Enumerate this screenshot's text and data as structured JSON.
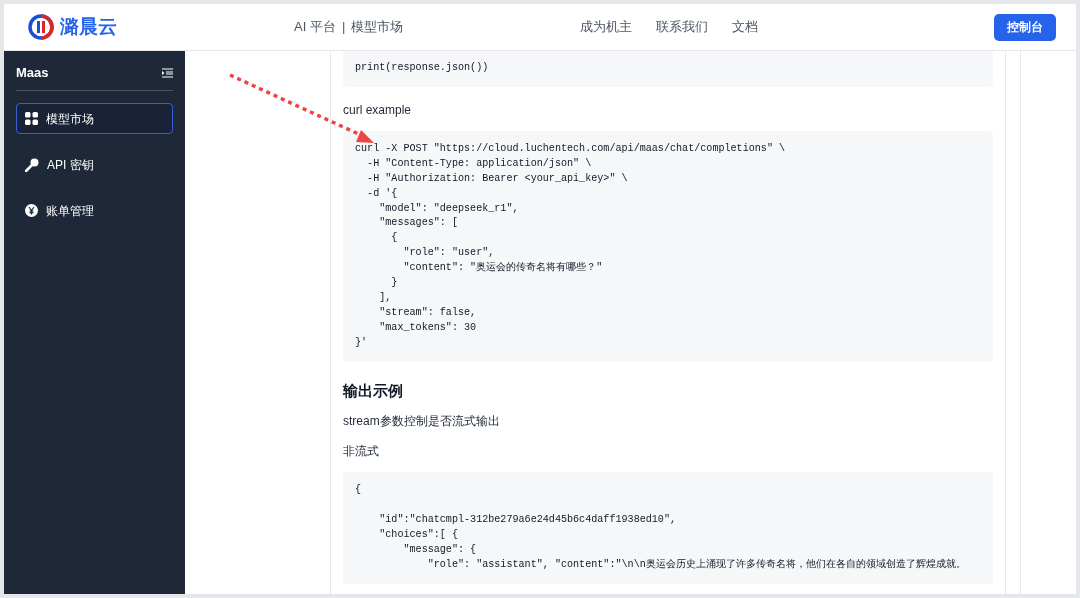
{
  "header": {
    "brand": "潞晨云",
    "breadcrumb": [
      "AI 平台",
      "|",
      "模型市场"
    ],
    "nav": [
      "成为机主",
      "联系我们",
      "文档"
    ],
    "console_button": "控制台"
  },
  "sidebar": {
    "title": "Maas",
    "items": [
      {
        "label": "模型市场",
        "kind": "grid",
        "selected": true
      },
      {
        "label": "API 密钥",
        "kind": "key",
        "selected": false
      },
      {
        "label": "账单管理",
        "kind": "yen",
        "selected": false
      }
    ]
  },
  "content": [
    {
      "kind": "code",
      "lines": [
        "print(response.json())"
      ]
    },
    {
      "kind": "text",
      "text": "curl example"
    },
    {
      "kind": "code",
      "lines": [
        "curl -X POST \"https://cloud.luchentech.com/api/maas/chat/completions\" \\",
        "  -H \"Content-Type: application/json\" \\",
        "  -H \"Authorization: Bearer <your_api_key>\" \\",
        "  -d '{",
        "    \"model\": \"deepseek_r1\",",
        "    \"messages\": [",
        "      {",
        "        \"role\": \"user\",",
        "        \"content\": \"奥运会的传奇名将有哪些？\"",
        "      }",
        "    ],",
        "    \"stream\": false,",
        "    \"max_tokens\": 30",
        "}'"
      ]
    },
    {
      "kind": "heading",
      "text": "输出示例"
    },
    {
      "kind": "text",
      "text": "stream参数控制是否流式输出"
    },
    {
      "kind": "text",
      "text": "非流式"
    },
    {
      "kind": "code",
      "spaced": true,
      "lines": [
        "{",
        "    \"id\":\"chatcmpl-312be279a6e24d45b6c4daff1938ed10\",",
        "    \"choices\":[ {",
        "        \"message\": {",
        "            \"role\": \"assistant\", \"content\":\"\\n\\n奥运会历史上涌现了许多传奇名将，他们在各自的领域创造了辉煌成就。"
      ]
    }
  ]
}
